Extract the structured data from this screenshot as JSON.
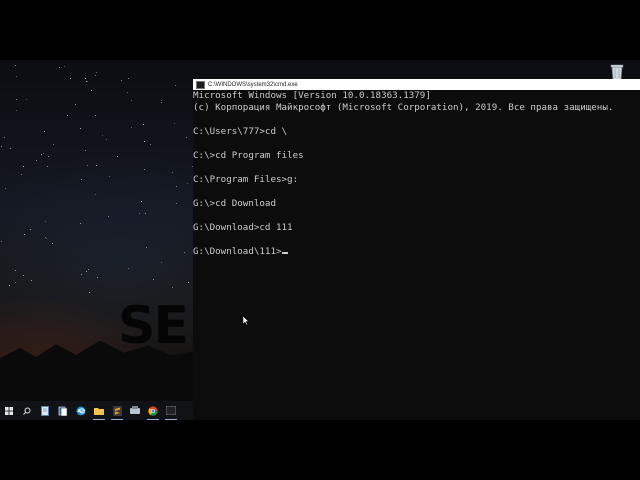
{
  "window": {
    "title": "C:\\WINDOWS\\system32\\cmd.exe"
  },
  "console": {
    "lines": [
      "Microsoft Windows [Version 10.0.18363.1379]",
      "(c) Корпорация Майкрософт (Microsoft Corporation), 2019. Все права защищены.",
      "",
      "C:\\Users\\777>cd \\",
      "",
      "C:\\>cd Program files",
      "",
      "C:\\Program Files>g:",
      "",
      "G:\\>cd Download",
      "",
      "G:\\Download>cd 111",
      "",
      "G:\\Download\\111>"
    ]
  },
  "desktop": {
    "wallpaper_text": "SE",
    "icons": [
      "recycle-bin-icon"
    ]
  },
  "taskbar": {
    "items": [
      {
        "name": "start-button",
        "icon": "windows-logo-icon"
      },
      {
        "name": "search-button",
        "icon": "search-icon"
      },
      {
        "name": "taskbar-notepad",
        "icon": "notepad-icon"
      },
      {
        "name": "taskbar-solitaire",
        "icon": "cards-icon"
      },
      {
        "name": "taskbar-edge",
        "icon": "edge-icon"
      },
      {
        "name": "taskbar-explorer",
        "icon": "folder-icon"
      },
      {
        "name": "taskbar-sublime",
        "icon": "sublime-icon"
      },
      {
        "name": "taskbar-app",
        "icon": "app-icon"
      },
      {
        "name": "taskbar-chrome",
        "icon": "chrome-icon"
      },
      {
        "name": "taskbar-cmd",
        "icon": "cmd-icon"
      }
    ]
  },
  "colors": {
    "console_bg": "#0c0c0c",
    "console_text": "#cccccc",
    "titlebar_bg": "#ffffff",
    "taskbar_bg": "#101215"
  }
}
